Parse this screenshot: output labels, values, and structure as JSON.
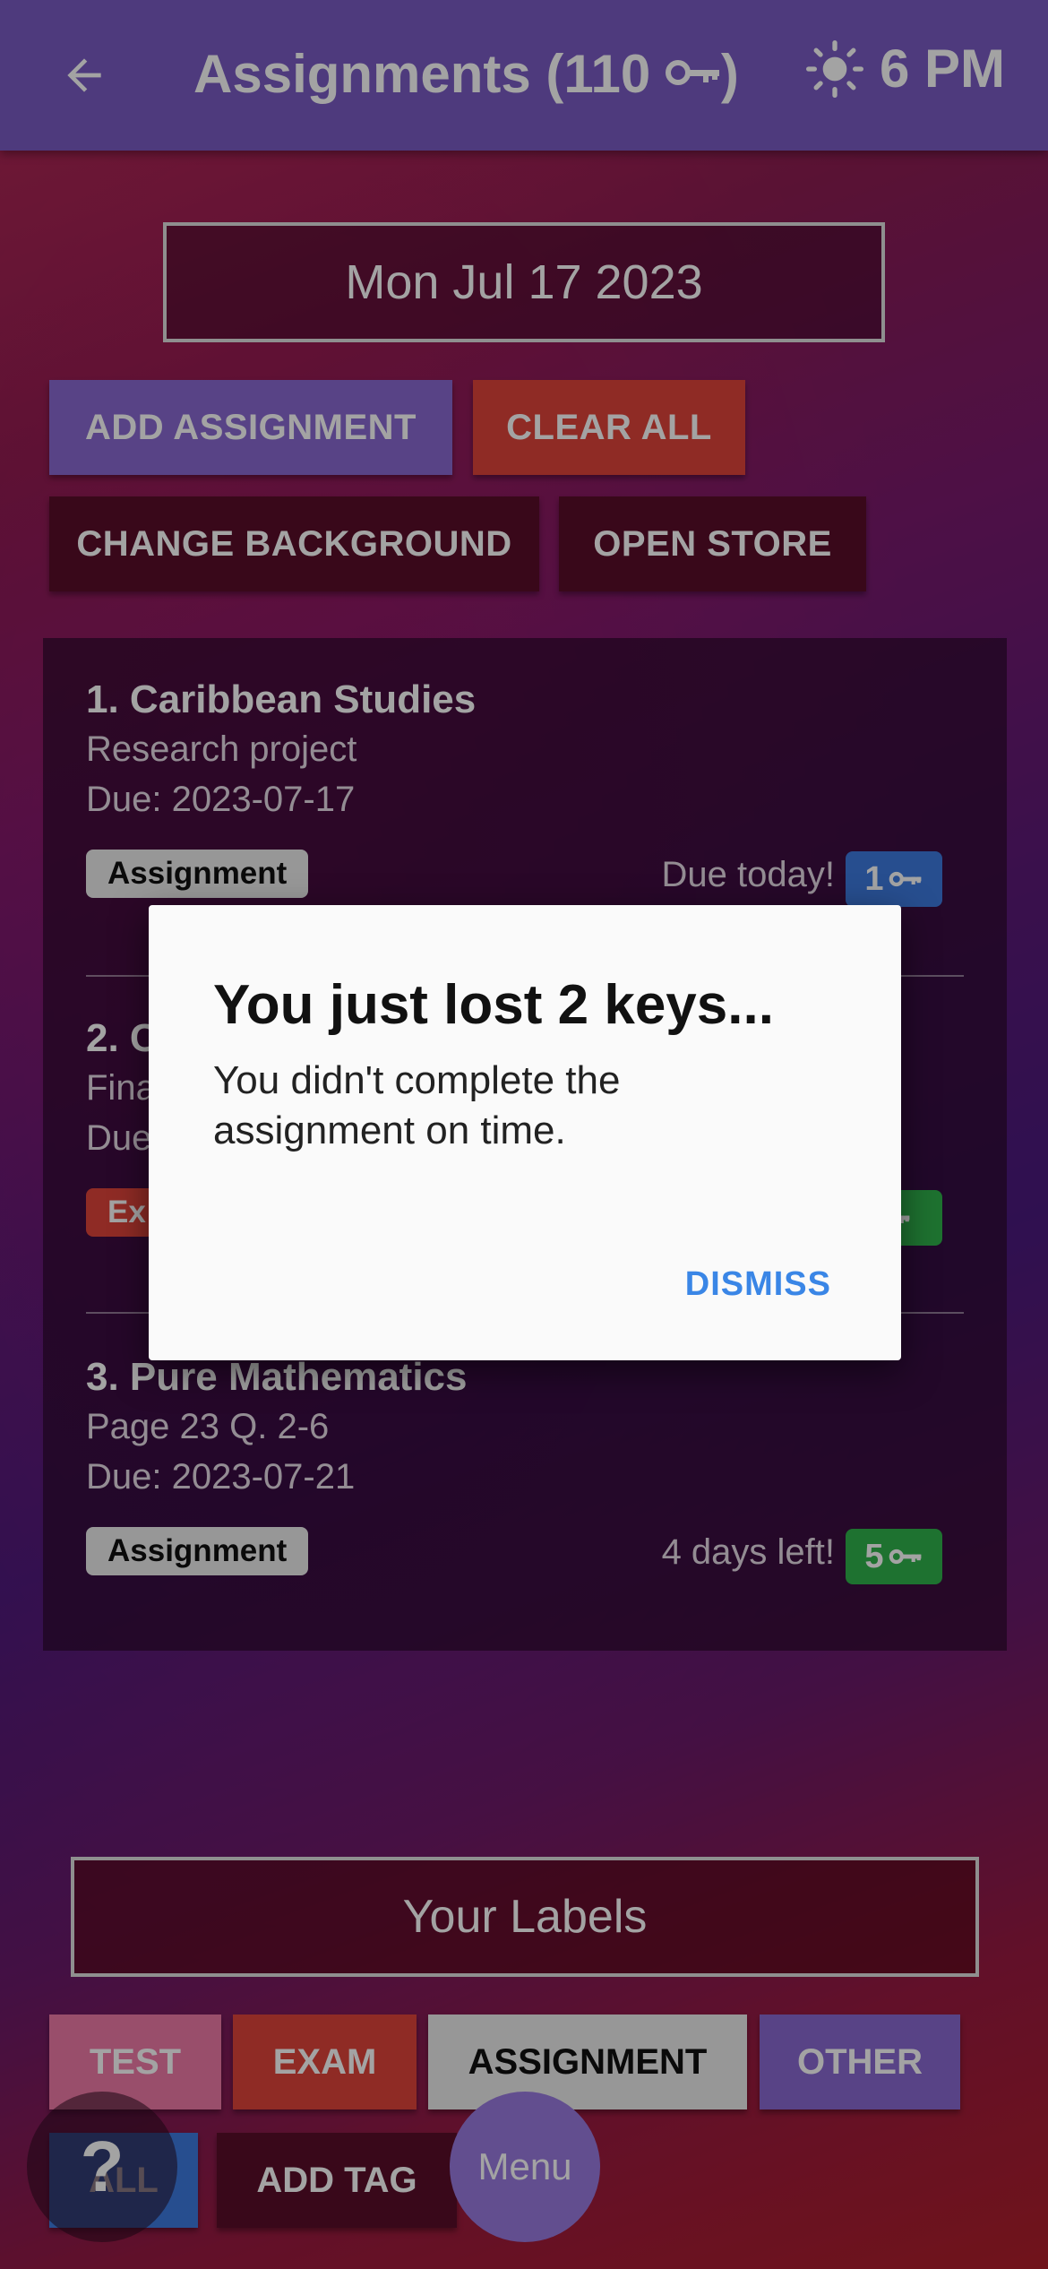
{
  "header": {
    "title": "Assignments (110 ",
    "title_suffix": ")",
    "weather_time": "6 PM"
  },
  "date": "Mon Jul 17 2023",
  "actions": {
    "add": "ADD ASSIGNMENT",
    "clear": "CLEAR ALL",
    "change_bg": "CHANGE BACKGROUND",
    "store": "OPEN STORE"
  },
  "assignments": [
    {
      "title": "1. Caribbean Studies",
      "desc": "Research project",
      "due": "Due: 2023-07-17",
      "tag": "Assignment",
      "status": "Due today!",
      "keys": "1",
      "badge_color": "#3d7be0"
    },
    {
      "title": "2. C",
      "desc": "Fina",
      "due": "Due",
      "tag": "Ex",
      "status": "",
      "keys": "",
      "badge_color": "#2fb24c"
    },
    {
      "title": "3. Pure Mathematics",
      "desc": "Page 23 Q. 2-6",
      "due": "Due: 2023-07-21",
      "tag": "Assignment",
      "status": "4 days left!",
      "keys": "5",
      "badge_color": "#2fb24c"
    }
  ],
  "labels": {
    "heading": "Your Labels",
    "chips": [
      "TEST",
      "EXAM",
      "ASSIGNMENT",
      "OTHER",
      "ALL"
    ],
    "add_tag": "ADD TAG"
  },
  "fab": {
    "help": "?",
    "menu": "Menu"
  },
  "dialog": {
    "title": "You just lost 2 keys...",
    "message": "You didn't complete the assignment on time.",
    "dismiss": "DISMISS"
  },
  "icons": [
    "back-arrow-icon",
    "key-icon",
    "sun-icon"
  ]
}
